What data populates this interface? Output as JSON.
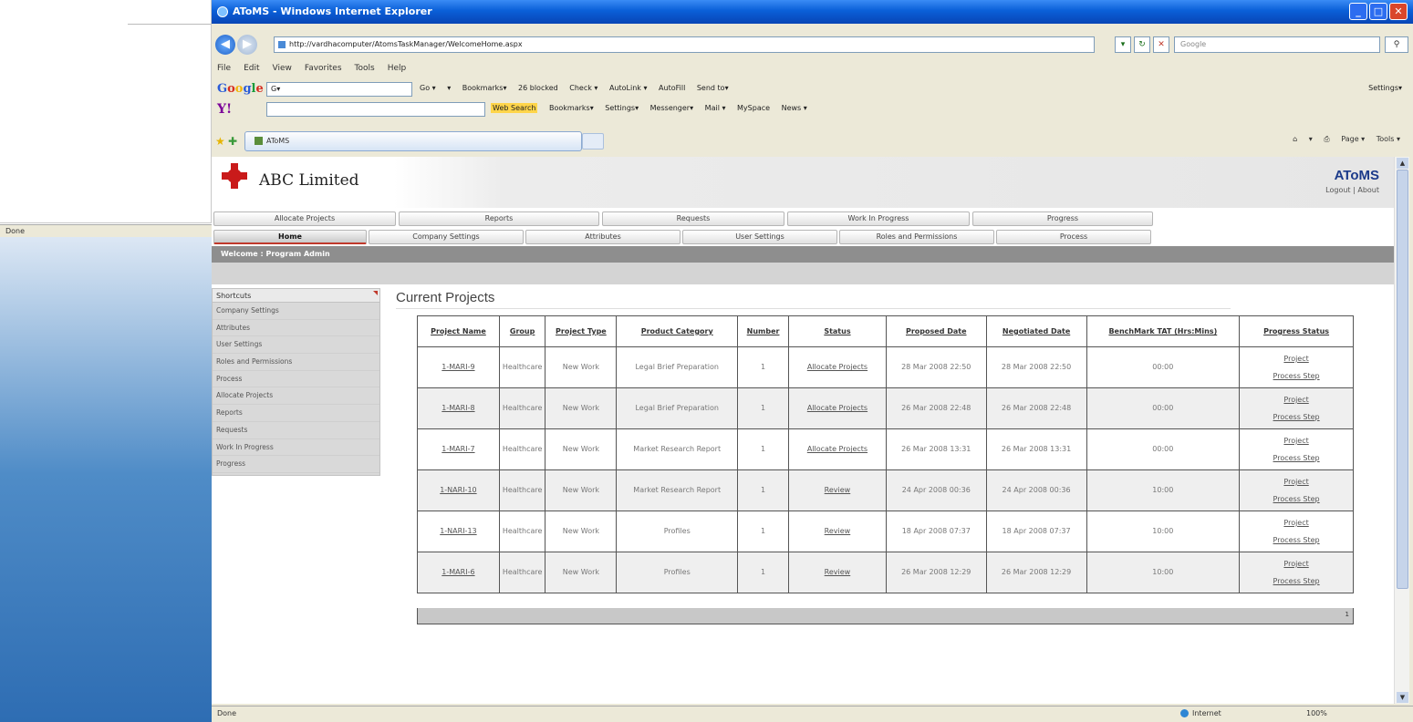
{
  "background_window": {
    "status": "Done"
  },
  "browser": {
    "title": "AToMS - Windows Internet Explorer",
    "address": "http://vardhacomputer/AtomsTaskManager/WelcomeHome.aspx",
    "search_placeholder": "Google",
    "menu": [
      "File",
      "Edit",
      "View",
      "Favorites",
      "Tools",
      "Help"
    ],
    "google_toolbar": {
      "logo": "Google",
      "input_prefix": "G▾",
      "items": [
        "Go ▾",
        "▾",
        "Bookmarks▾",
        "26 blocked",
        "Check ▾",
        "AutoLink ▾",
        "AutoFill",
        "Send to▾"
      ],
      "settings": "Settings▾"
    },
    "yahoo_toolbar": {
      "logo": "Y!",
      "search_label": "Web Search",
      "items": [
        "Bookmarks▾",
        "Settings▾",
        "Messenger▾",
        "Mail ▾",
        "MySpace",
        "News ▾"
      ]
    },
    "tab_label": "AToMS",
    "command_bar": [
      "▾",
      "Page ▾",
      "Tools ▾"
    ],
    "status": {
      "text": "Done",
      "zone": "Internet",
      "zoom": "100%"
    },
    "window_buttons": {
      "minimize": "_",
      "maximize": "□",
      "close": "✕"
    }
  },
  "app": {
    "company": "ABC Limited",
    "brand": "AToMS",
    "header_links": "Logout | About",
    "menu_row1": [
      "Allocate Projects",
      "Reports",
      "Requests",
      "Work In Progress",
      "Progress"
    ],
    "menu_row2": [
      "Home",
      "Company Settings",
      "Attributes",
      "User Settings",
      "Roles and Permissions",
      "Process"
    ],
    "welcome": "Welcome : Program Admin",
    "shortcuts": {
      "title": "Shortcuts",
      "items": [
        "Company Settings",
        "Attributes",
        "User Settings",
        "Roles and Permissions",
        "Process",
        "Allocate Projects",
        "Reports",
        "Requests",
        "Work In Progress",
        "Progress"
      ]
    },
    "section_title": "Current Projects",
    "table": {
      "headers": [
        "Project Name",
        "Group",
        "Project Type",
        "Product Category",
        "Number",
        "Status",
        "Proposed Date",
        "Negotiated Date",
        "BenchMark TAT (Hrs:Mins)",
        "Progress Status"
      ],
      "rows": [
        {
          "name": "1-MARI-9",
          "group": "Healthcare",
          "type": "New Work",
          "category": "Legal Brief Preparation",
          "number": "1",
          "status": "Allocate Projects",
          "proposed": "28 Mar 2008 22:50",
          "negotiated": "28 Mar 2008 22:50",
          "tat": "00:00",
          "progress": "Project",
          "step": "Process Step"
        },
        {
          "name": "1-MARI-8",
          "group": "Healthcare",
          "type": "New Work",
          "category": "Legal Brief Preparation",
          "number": "1",
          "status": "Allocate Projects",
          "proposed": "26 Mar 2008 22:48",
          "negotiated": "26 Mar 2008 22:48",
          "tat": "00:00",
          "progress": "Project",
          "step": "Process Step"
        },
        {
          "name": "1-MARI-7",
          "group": "Healthcare",
          "type": "New Work",
          "category": "Market Research Report",
          "number": "1",
          "status": "Allocate Projects",
          "proposed": "26 Mar 2008 13:31",
          "negotiated": "26 Mar 2008 13:31",
          "tat": "00:00",
          "progress": "Project",
          "step": "Process Step"
        },
        {
          "name": "1-NARI-10",
          "group": "Healthcare",
          "type": "New Work",
          "category": "Market Research Report",
          "number": "1",
          "status": "Review",
          "proposed": "24 Apr 2008 00:36",
          "negotiated": "24 Apr 2008 00:36",
          "tat": "10:00",
          "progress": "Project",
          "step": "Process Step"
        },
        {
          "name": "1-NARI-13",
          "group": "Healthcare",
          "type": "New Work",
          "category": "Profiles",
          "number": "1",
          "status": "Review",
          "proposed": "18 Apr 2008 07:37",
          "negotiated": "18 Apr 2008 07:37",
          "tat": "10:00",
          "progress": "Project",
          "step": "Process Step"
        },
        {
          "name": "1-MARI-6",
          "group": "Healthcare",
          "type": "New Work",
          "category": "Profiles",
          "number": "1",
          "status": "Review",
          "proposed": "26 Mar 2008 12:29",
          "negotiated": "26 Mar 2008 12:29",
          "tat": "10:00",
          "progress": "Project",
          "step": "Process Step"
        }
      ],
      "pager": "1"
    }
  },
  "colors": {
    "titlebar": "#0a5fd8",
    "brand": "#1b3a8a",
    "accent_red": "#c0392b",
    "welcome_bar": "#8e8e8e"
  }
}
